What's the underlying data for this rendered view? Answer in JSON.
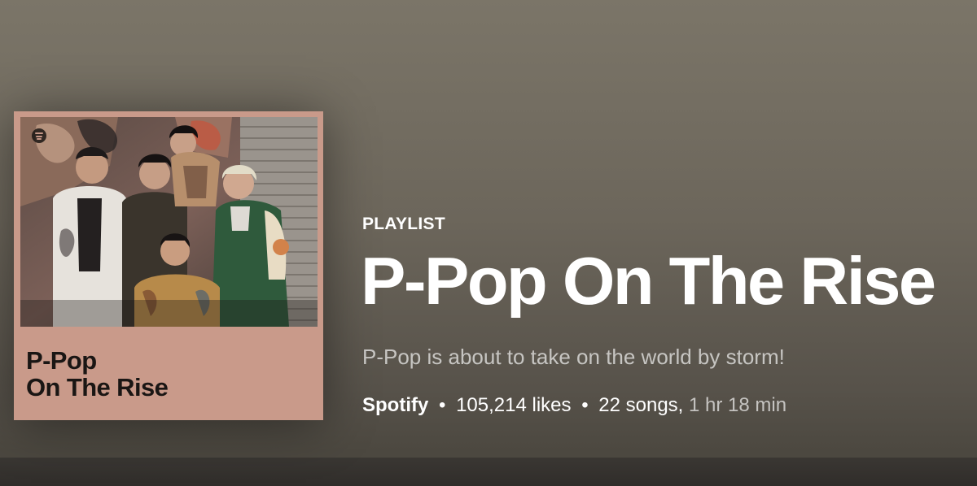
{
  "header": {
    "type_label": "PLAYLIST",
    "title": "P-Pop On The Rise",
    "description": "P-Pop is about to take on the world by storm!",
    "owner": "Spotify",
    "separator": "•",
    "likes": "105,214 likes",
    "songs": "22 songs,",
    "duration": "1 hr 18 min"
  },
  "cover": {
    "title_line1": "P-Pop",
    "title_line2": "On The Rise",
    "background_color": "#c99a8a",
    "badge_icon": "spotify-logo-icon"
  },
  "colors": {
    "gradient_top": "#7b7568",
    "gradient_bottom": "#4c4840",
    "text_primary": "#ffffff"
  }
}
